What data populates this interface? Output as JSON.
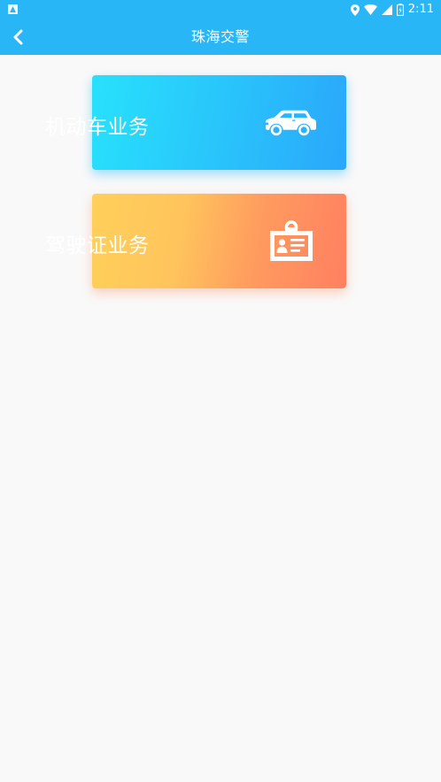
{
  "status_bar": {
    "time": "2:11",
    "icons": [
      "location-icon",
      "wifi-icon",
      "signal-icon",
      "battery-icon"
    ]
  },
  "nav": {
    "title": "珠海交警",
    "back_icon": "chevron-left-icon"
  },
  "cards": [
    {
      "label": "机动车业务",
      "icon": "car-icon"
    },
    {
      "label": "驾驶证业务",
      "icon": "id-card-icon"
    }
  ],
  "colors": {
    "header": "#29b6f6",
    "background": "#f9f9f9",
    "vehicle_gradient": [
      "#28e1fc",
      "#2aa7fb"
    ],
    "license_gradient": [
      "#ffd05a",
      "#ff8060"
    ]
  }
}
